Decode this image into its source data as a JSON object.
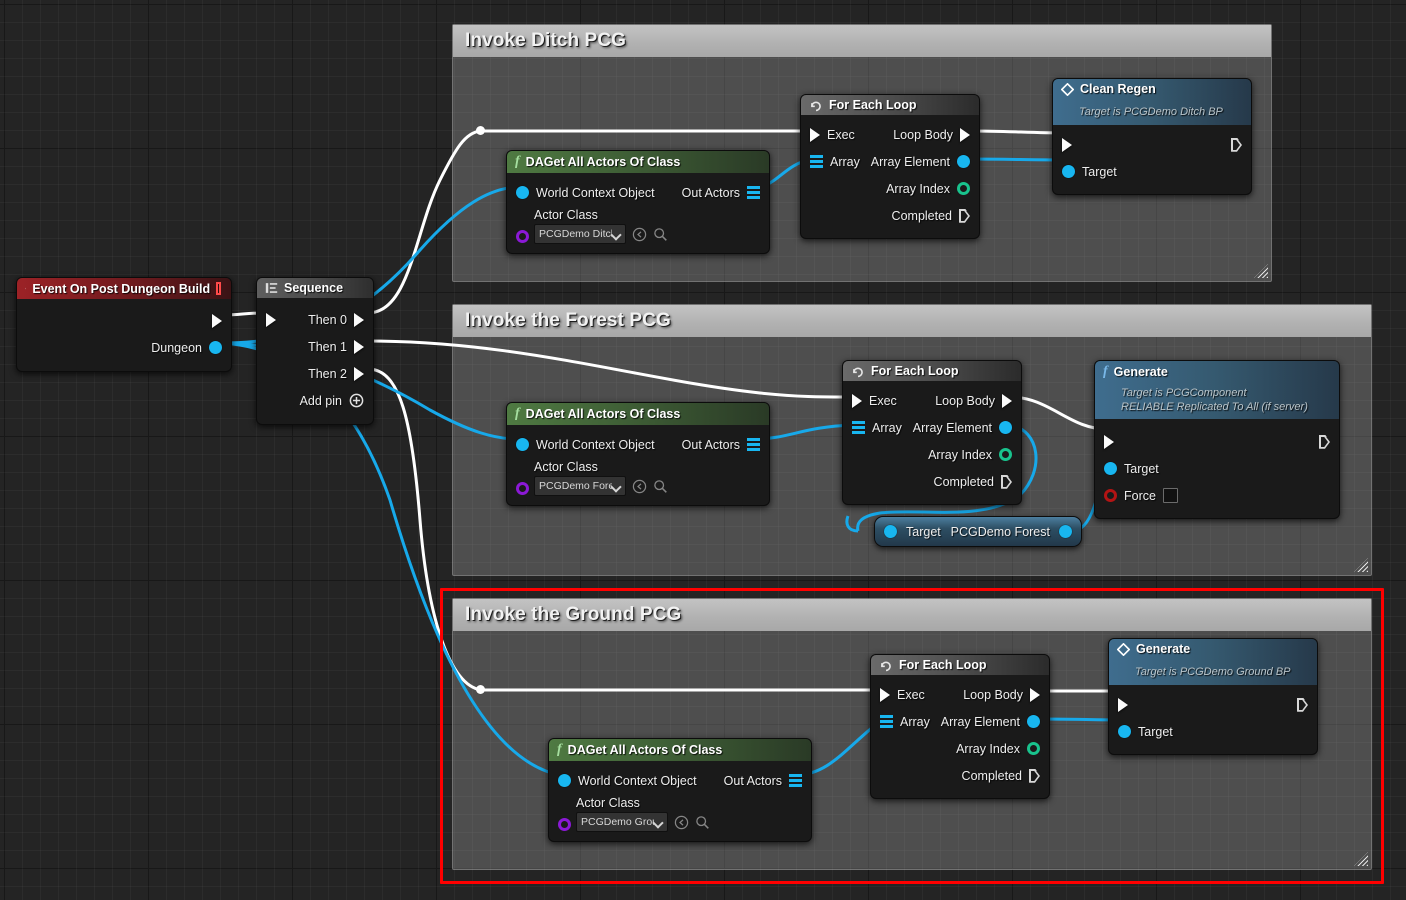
{
  "graph": {
    "background_color": "#242424",
    "highlight_color": "#ff0000"
  },
  "comments": [
    {
      "title": "Invoke Ditch PCG"
    },
    {
      "title": "Invoke the Forest PCG"
    },
    {
      "title": "Invoke the Ground PCG"
    }
  ],
  "nodes": {
    "event": {
      "title": "Event On Post Dungeon Build",
      "pins": {
        "dungeon": "Dungeon"
      }
    },
    "sequence": {
      "title": "Sequence",
      "pins": {
        "then0": "Then 0",
        "then1": "Then 1",
        "then2": "Then 2",
        "addpin": "Add pin"
      }
    },
    "daget_ditch": {
      "title": "DAGet All Actors Of Class",
      "pins": {
        "world": "World Context Object",
        "out": "Out Actors",
        "class_label": "Actor Class"
      },
      "class_value": "PCGDemo Ditch"
    },
    "daget_forest": {
      "title": "DAGet All Actors Of Class",
      "pins": {
        "world": "World Context Object",
        "out": "Out Actors",
        "class_label": "Actor Class"
      },
      "class_value": "PCGDemo Fores"
    },
    "daget_ground": {
      "title": "DAGet All Actors Of Class",
      "pins": {
        "world": "World Context Object",
        "out": "Out Actors",
        "class_label": "Actor Class"
      },
      "class_value": "PCGDemo Groun"
    },
    "loop_ditch": {
      "title": "For Each Loop",
      "pins": {
        "exec": "Exec",
        "array": "Array",
        "body": "Loop Body",
        "element": "Array Element",
        "index": "Array Index",
        "completed": "Completed"
      }
    },
    "loop_forest": {
      "title": "For Each Loop",
      "pins": {
        "exec": "Exec",
        "array": "Array",
        "body": "Loop Body",
        "element": "Array Element",
        "index": "Array Index",
        "completed": "Completed"
      }
    },
    "loop_ground": {
      "title": "For Each Loop",
      "pins": {
        "exec": "Exec",
        "array": "Array",
        "body": "Loop Body",
        "element": "Array Element",
        "index": "Array Index",
        "completed": "Completed"
      }
    },
    "clean_regen": {
      "title": "Clean Regen",
      "subtitle": "Target is PCGDemo Ditch BP",
      "pins": {
        "target": "Target"
      }
    },
    "generate_forest": {
      "title": "Generate",
      "subtitle_line1": "Target is PCGComponent",
      "subtitle_line2": "RELIABLE Replicated To All (if server)",
      "pins": {
        "target": "Target",
        "force": "Force"
      }
    },
    "generate_ground": {
      "title": "Generate",
      "subtitle": "Target is PCGDemo Ground BP",
      "pins": {
        "target": "Target"
      }
    },
    "var_forest": {
      "pins": {
        "target": "Target",
        "value": "PCGDemo Forest"
      }
    }
  }
}
